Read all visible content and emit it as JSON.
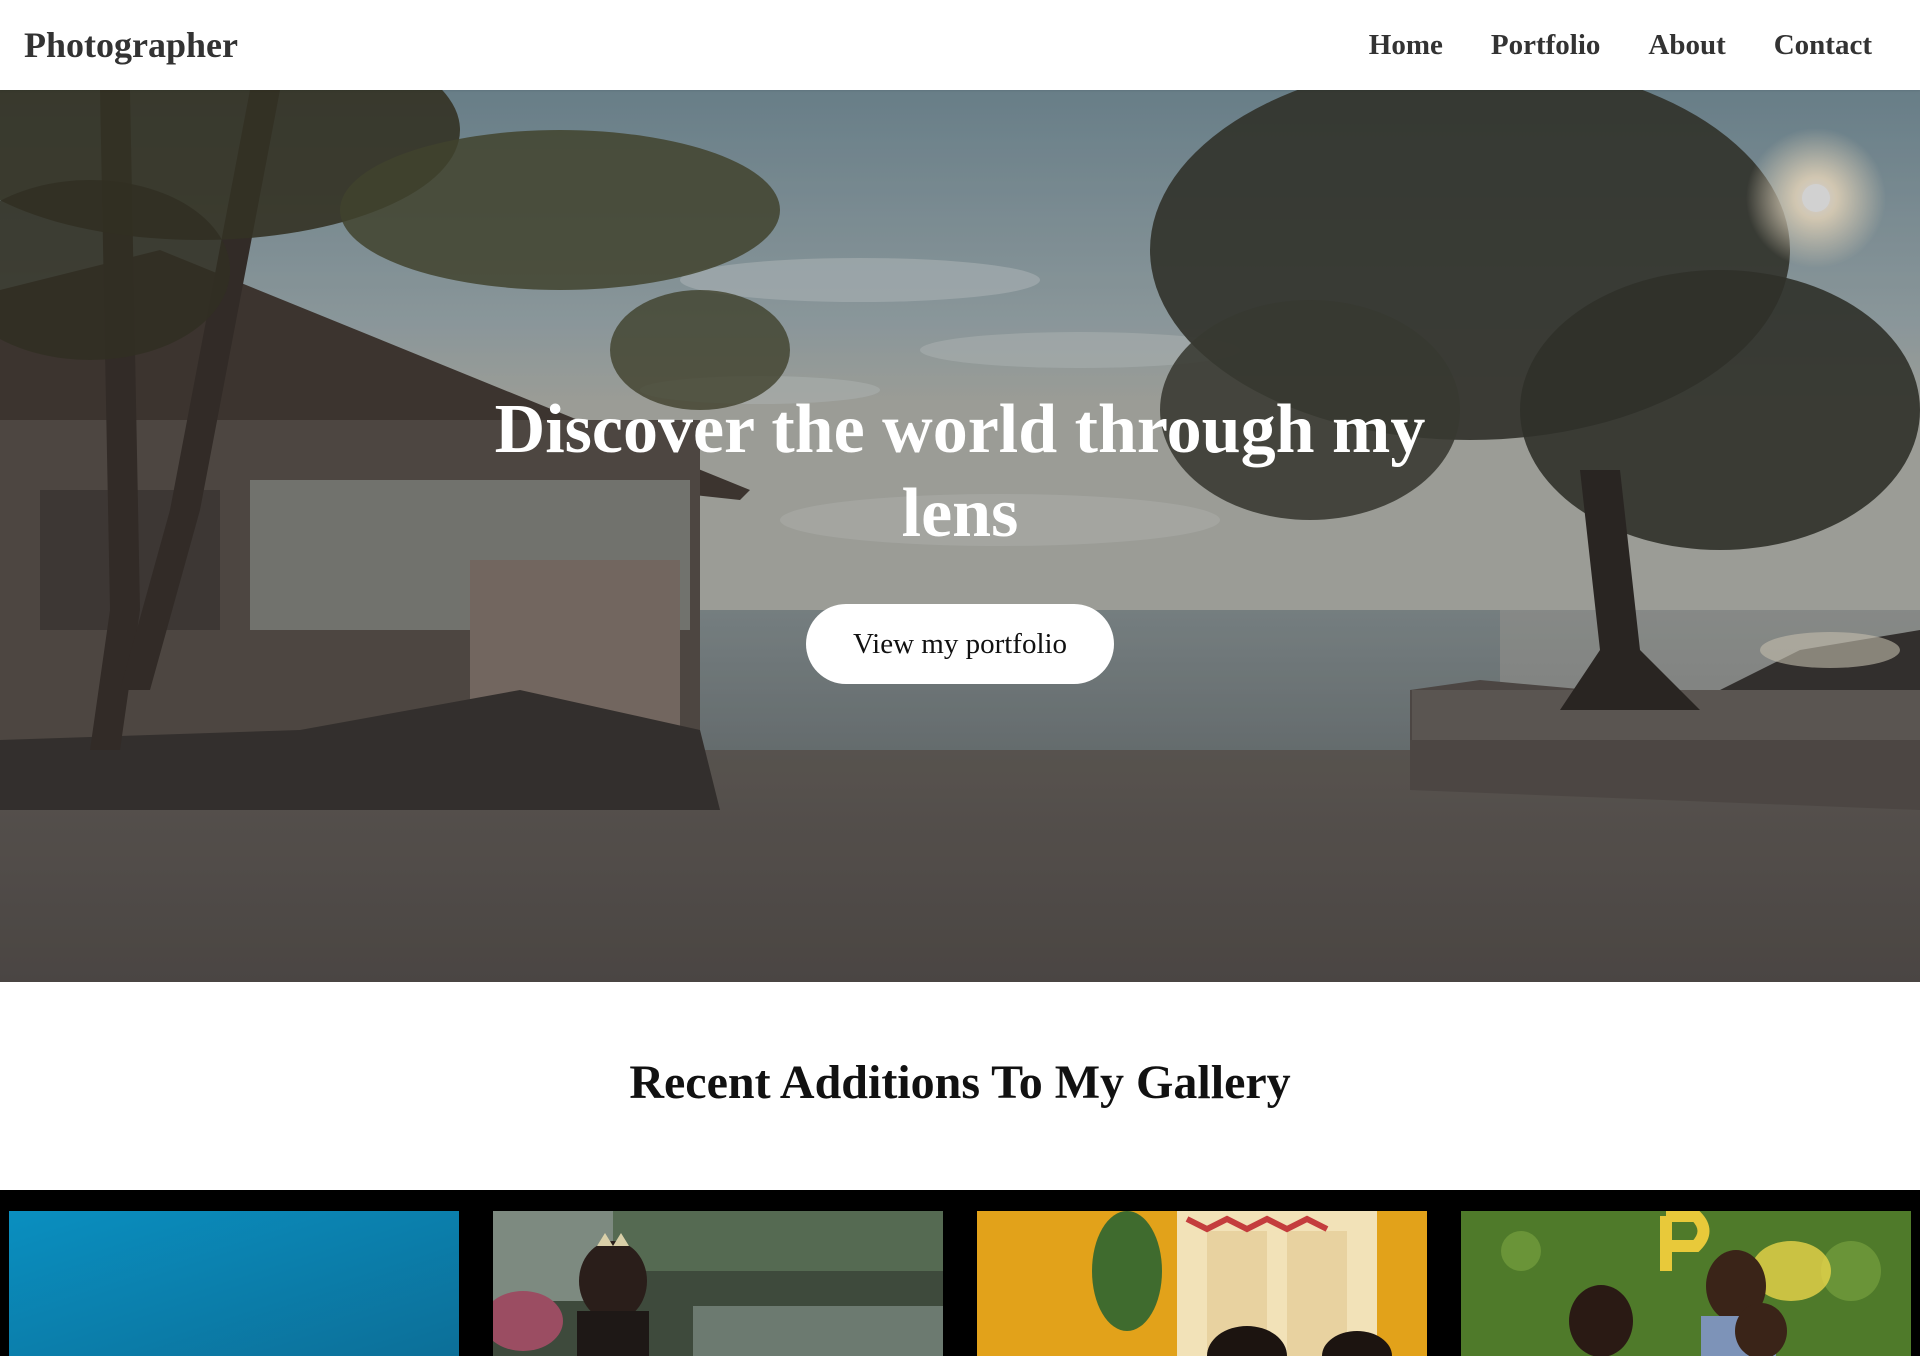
{
  "header": {
    "brand": "Photographer",
    "nav": [
      "Home",
      "Portfolio",
      "About",
      "Contact"
    ]
  },
  "hero": {
    "title": "Discover the world through my lens",
    "button_label": "View my portfolio"
  },
  "gallery": {
    "heading": "Recent Additions To My Gallery",
    "items": [
      {
        "subject": "blue-backdrop-photo"
      },
      {
        "subject": "crowned-woman-outdoor-photo"
      },
      {
        "subject": "family-portrait-yellow-room-photo"
      },
      {
        "subject": "children-green-wall-photo"
      }
    ]
  },
  "colors": {
    "header_bg": "#ffffff",
    "nav_text": "#333333",
    "hero_button_bg": "#ffffff",
    "gallery_bg": "#000000"
  }
}
